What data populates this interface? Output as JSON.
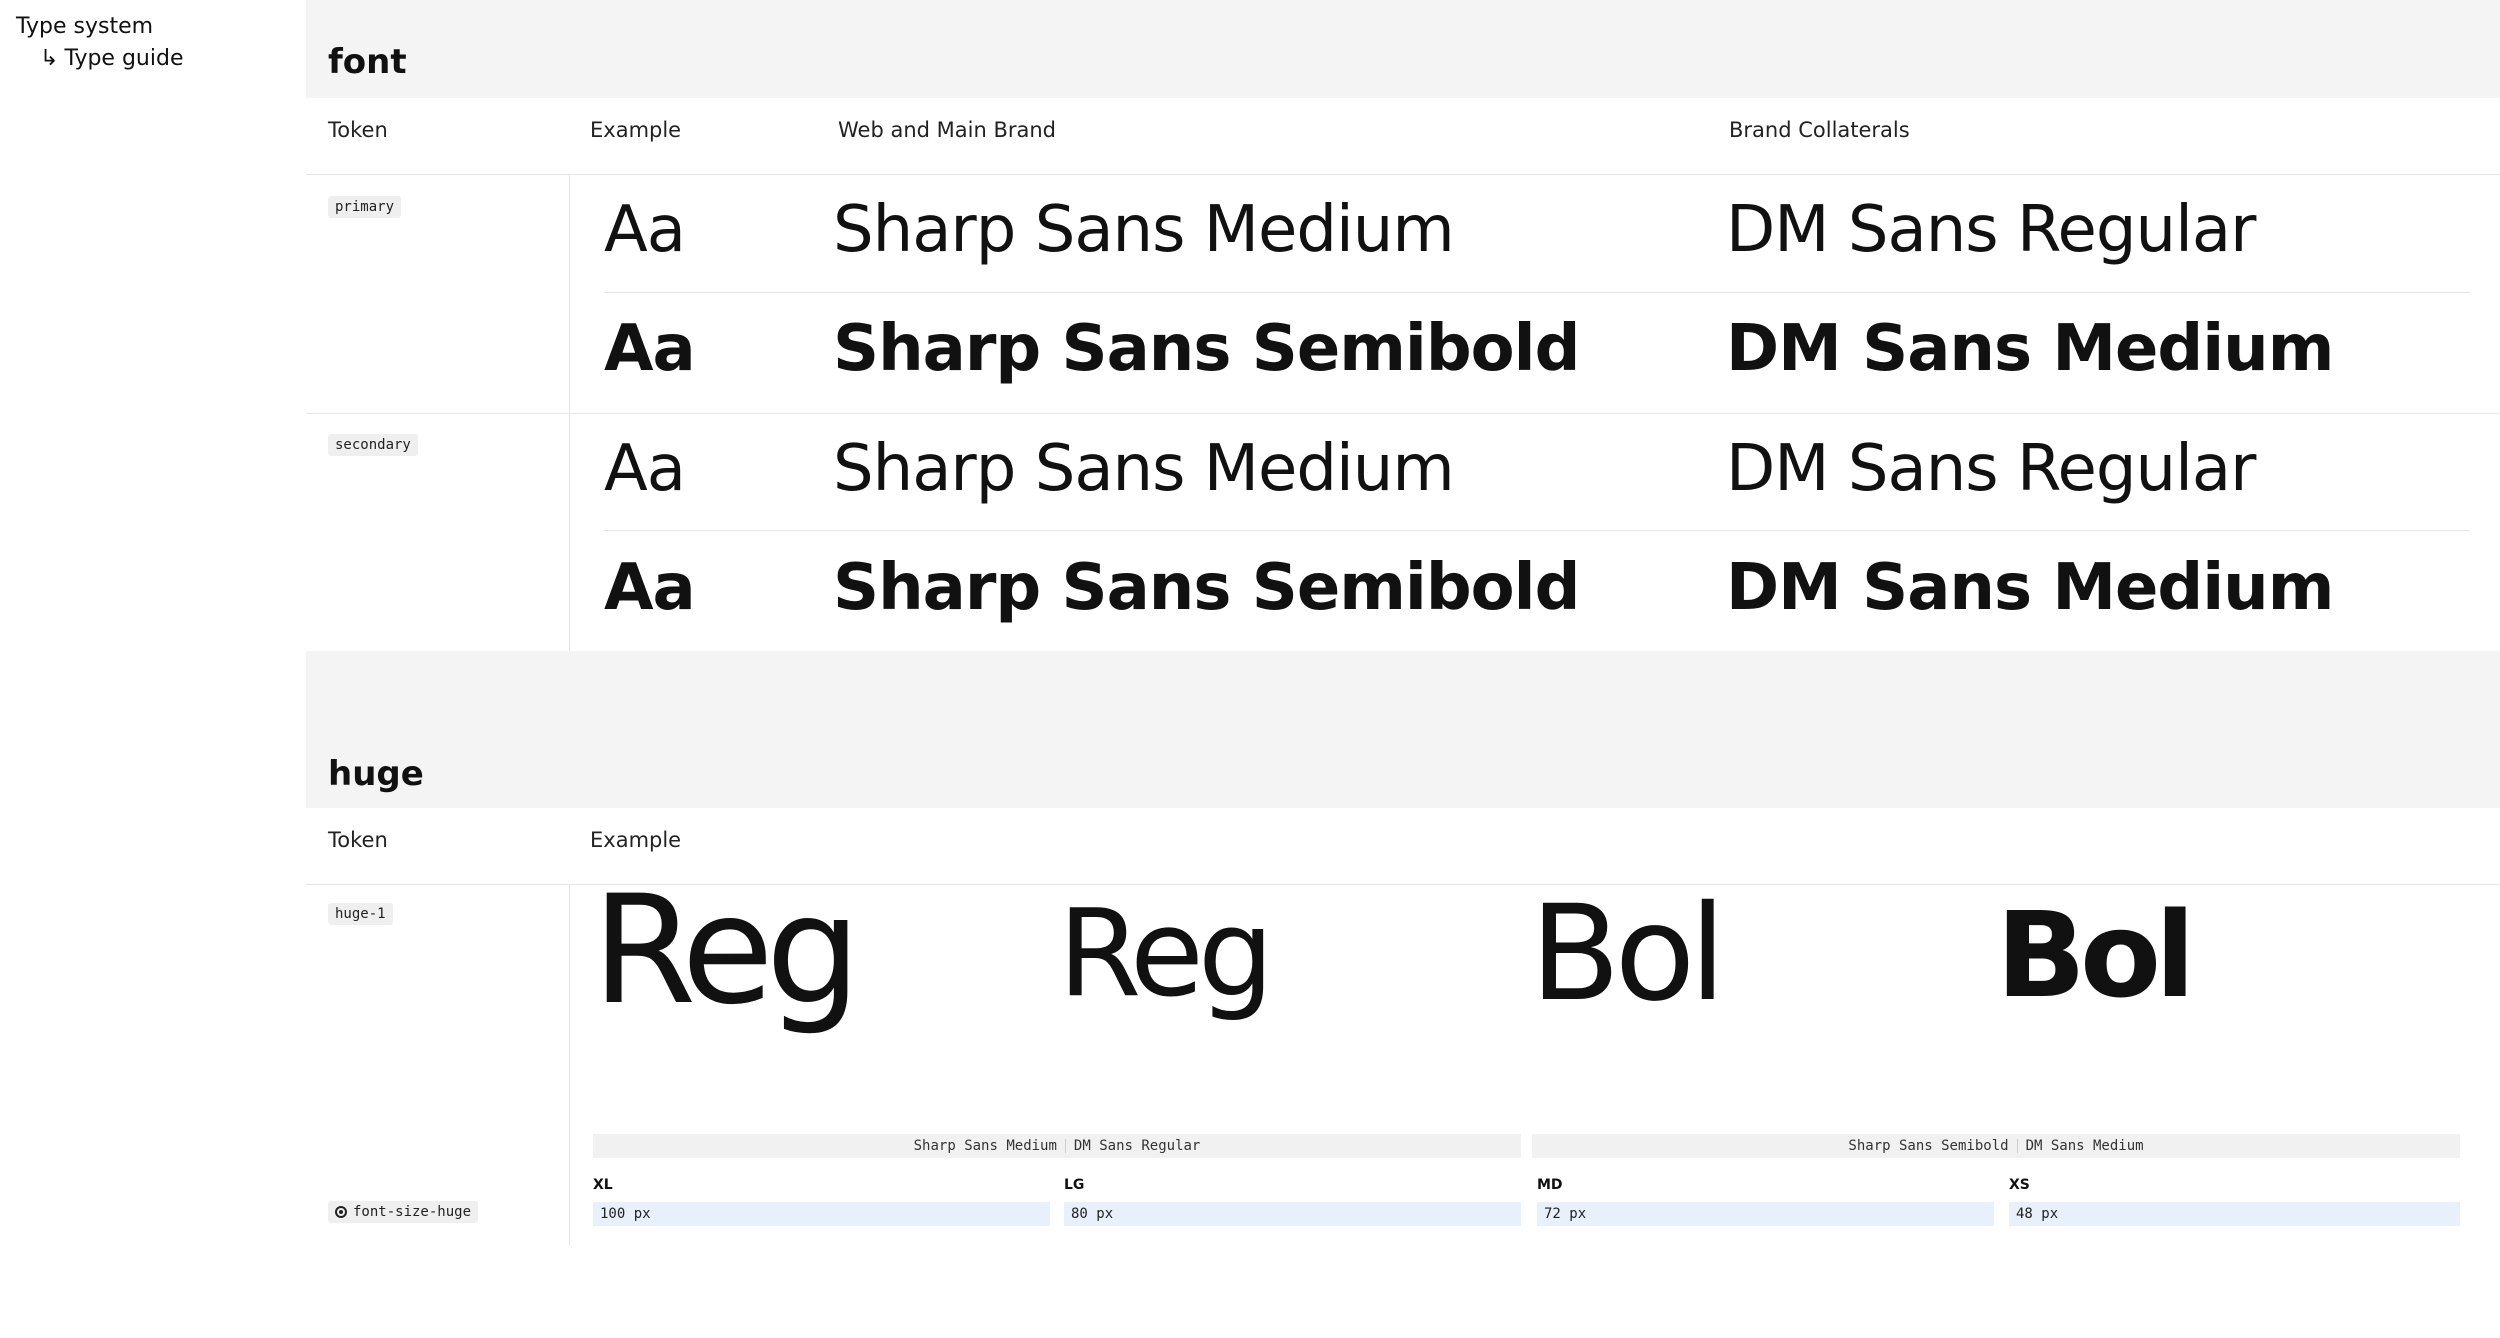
{
  "sidebar": {
    "root_label": "Type system",
    "child_arrow": "↳",
    "child_label": "Type guide"
  },
  "font_section": {
    "title": "font",
    "headers": {
      "token": "Token",
      "example": "Example",
      "web": "Web and Main Brand",
      "collateral": "Brand Collaterals"
    },
    "rows": [
      {
        "token": "primary",
        "variants": [
          {
            "example": "Aa",
            "web": "Sharp Sans Medium",
            "collateral": "DM Sans Regular"
          },
          {
            "example": "Aa",
            "web": "Sharp Sans Semibold",
            "collateral": "DM Sans Medium"
          }
        ]
      },
      {
        "token": "secondary",
        "variants": [
          {
            "example": "Aa",
            "web": "Sharp Sans Medium",
            "collateral": "DM Sans Regular"
          },
          {
            "example": "Aa",
            "web": "Sharp Sans Semibold",
            "collateral": "DM Sans Medium"
          }
        ]
      }
    ]
  },
  "huge_section": {
    "title": "huge",
    "headers": {
      "token": "Token",
      "example": "Example"
    },
    "token": "huge-1",
    "samples": [
      "Reg",
      "Reg",
      "Bol",
      "Bol"
    ],
    "font_bars": [
      {
        "web": "Sharp Sans Medium",
        "collateral": "DM Sans Regular"
      },
      {
        "web": "Sharp Sans Semibold",
        "collateral": "DM Sans Medium"
      }
    ],
    "sizes": [
      {
        "label": "XL",
        "value": "100 px"
      },
      {
        "label": "LG",
        "value": "80 px"
      },
      {
        "label": "MD",
        "value": "72 px"
      },
      {
        "label": "XS",
        "value": "48 px"
      }
    ],
    "variable": "font-size-huge"
  }
}
